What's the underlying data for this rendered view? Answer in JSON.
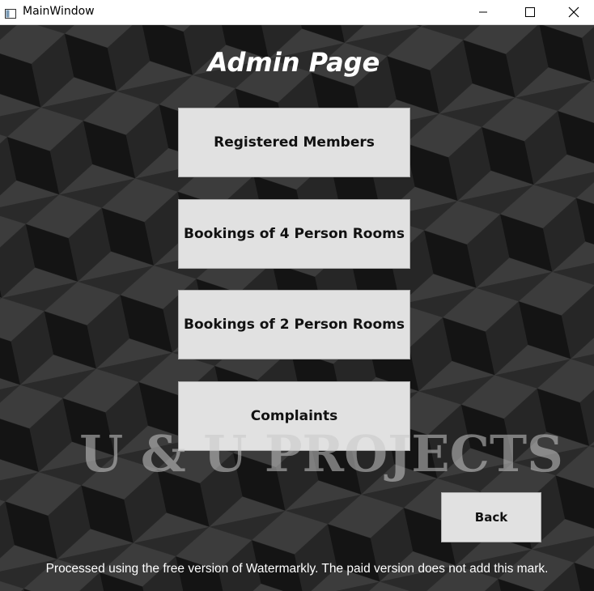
{
  "window": {
    "title": "MainWindow",
    "icons": {
      "app": "window-app-icon",
      "minimize": "minimize-icon",
      "maximize": "maximize-icon",
      "close": "close-icon"
    }
  },
  "page": {
    "title": "Admin Page",
    "buttons": {
      "registered_members": "Registered Members",
      "bookings_4": "Bookings of 4 Person Rooms",
      "bookings_2": "Bookings of 2 Person Rooms",
      "complaints": "Complaints",
      "back": "Back"
    },
    "watermark": "U & U PROJECTS",
    "footer_note": "Processed using the free version of Watermarkly. The paid version does not add this mark."
  },
  "colors": {
    "button_bg": "#e1e1e1",
    "background": "#1e1e1e",
    "title_text": "#ffffff"
  }
}
